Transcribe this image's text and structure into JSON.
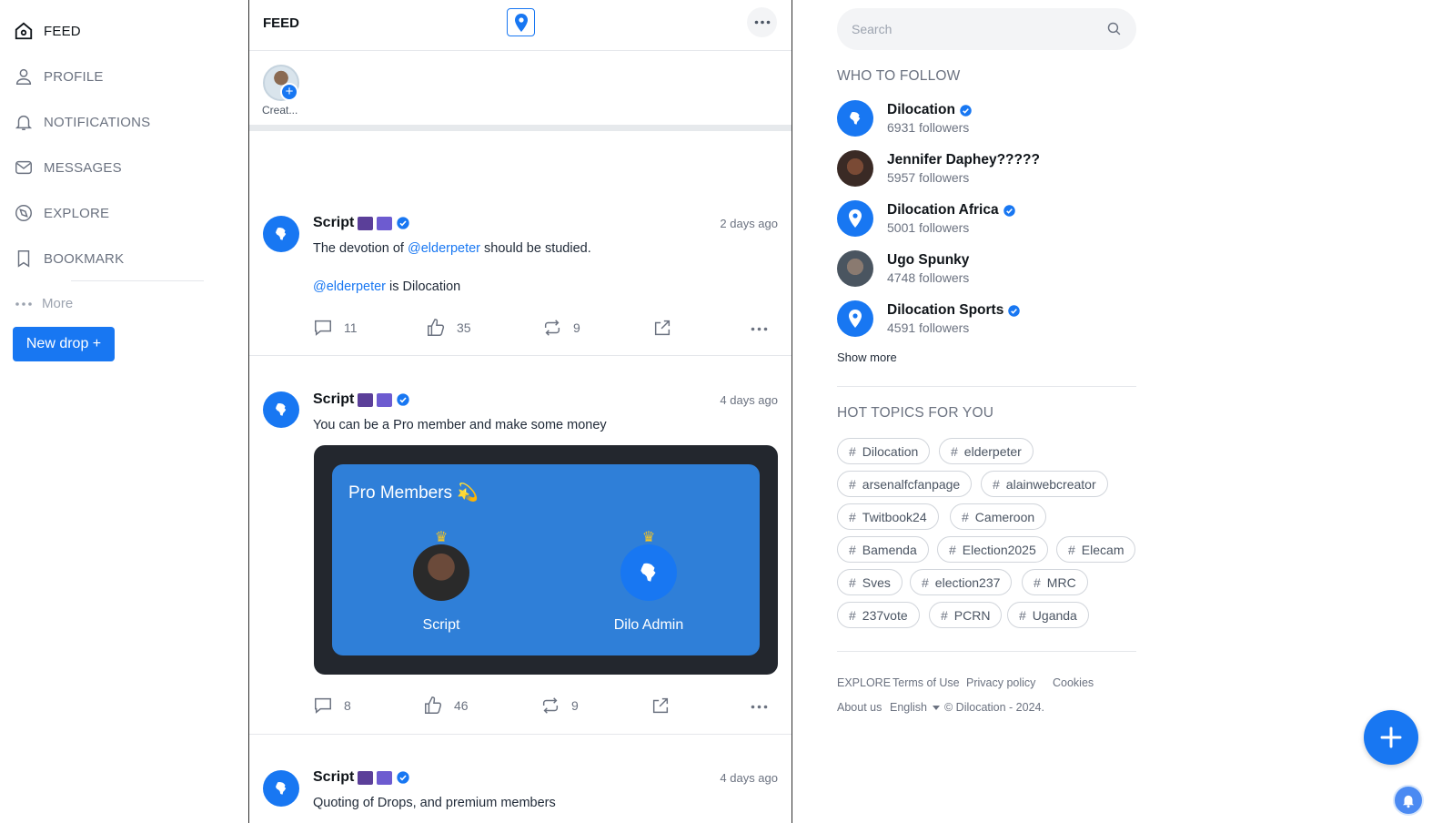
{
  "sidebar": {
    "items": [
      {
        "label": "FEED",
        "icon": "home-icon"
      },
      {
        "label": "PROFILE",
        "icon": "user-icon"
      },
      {
        "label": "NOTIFICATIONS",
        "icon": "bell-icon"
      },
      {
        "label": "MESSAGES",
        "icon": "mail-icon"
      },
      {
        "label": "EXPLORE",
        "icon": "compass-icon"
      },
      {
        "label": "BOOKMARK",
        "icon": "bookmark-icon"
      }
    ],
    "more_label": "More",
    "new_drop_label": "New drop +"
  },
  "feed": {
    "title": "FEED",
    "story": {
      "label": "Creat..."
    },
    "posts": [
      {
        "author": "Script",
        "time": "2 days ago",
        "line1_prefix": "The devotion of ",
        "line1_mention": "@elderpeter",
        "line1_suffix": " should be studied.",
        "line2_mention": "@elderpeter",
        "line2_suffix": " is Dilocation",
        "comments": "11",
        "likes": "35",
        "reposts": "9"
      },
      {
        "author": "Script",
        "time": "4 days ago",
        "text": "You can be a Pro member and make some money",
        "card": {
          "title": "Pro Members 💫",
          "members": [
            {
              "name": "Script"
            },
            {
              "name": "Dilo Admin"
            }
          ]
        },
        "comments": "8",
        "likes": "46",
        "reposts": "9"
      },
      {
        "author": "Script",
        "time": "4 days ago",
        "text": "Quoting of Drops, and premium members"
      }
    ]
  },
  "right": {
    "search_placeholder": "Search",
    "who_to_follow_title": "WHO TO FOLLOW",
    "follow": [
      {
        "name": "Dilocation",
        "followers": "6931 followers",
        "verified": true
      },
      {
        "name": "Jennifer Daphey?????",
        "followers": "5957 followers",
        "verified": false
      },
      {
        "name": "Dilocation Africa",
        "followers": "5001 followers",
        "verified": true
      },
      {
        "name": "Ugo Spunky",
        "followers": "4748 followers",
        "verified": false
      },
      {
        "name": "Dilocation Sports",
        "followers": "4591 followers",
        "verified": true
      }
    ],
    "show_more": "Show more",
    "hot_topics_title": "HOT TOPICS FOR YOU",
    "topics": [
      "Dilocation",
      "elderpeter",
      "arsenalfcfanpage",
      "alainwebcreator",
      "Twitbook24",
      "Cameroon",
      "Bamenda",
      "Election2025",
      "Elecam",
      "Sves",
      "election237",
      "MRC",
      "237vote",
      "PCRN",
      "Uganda"
    ],
    "footer": {
      "explore": "EXPLORE",
      "terms": "Terms of Use",
      "privacy": "Privacy policy",
      "cookies": "Cookies",
      "about": "About us",
      "language": "English",
      "copyright": "© Dilocation - 2024."
    }
  },
  "colors": {
    "accent": "#1877f2",
    "card_dark": "#23272e",
    "card_blue": "#2f7fd8",
    "crown": "#f6c624"
  }
}
